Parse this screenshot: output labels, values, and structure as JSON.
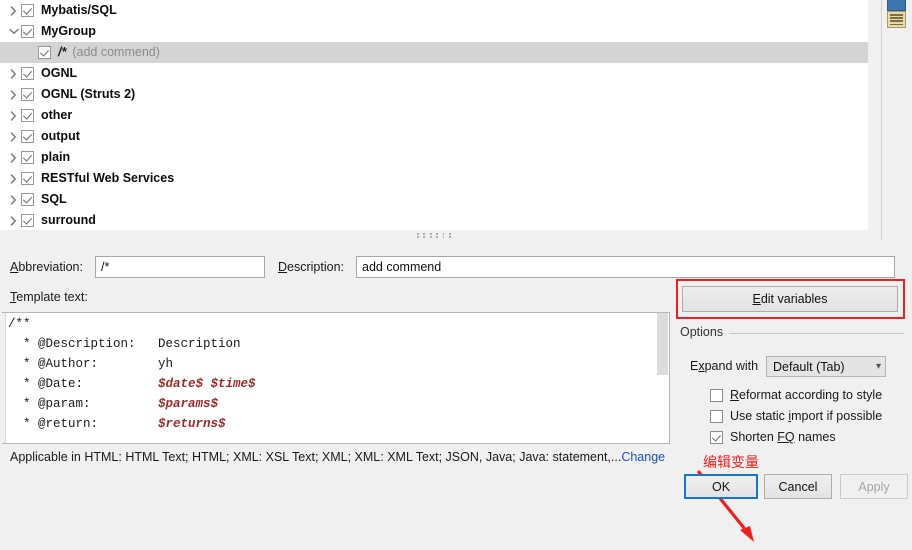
{
  "tree": {
    "items": [
      {
        "label": "Mybatis/SQL",
        "twisty": "chevron-right-icon",
        "checked": true,
        "level": 0,
        "selected": false,
        "desc": ""
      },
      {
        "label": "MyGroup",
        "twisty": "chevron-down-icon",
        "checked": true,
        "level": 0,
        "selected": false,
        "desc": ""
      },
      {
        "label": "/*",
        "twisty": "none",
        "checked": true,
        "level": 1,
        "selected": true,
        "desc": "(add commend)"
      },
      {
        "label": "OGNL",
        "twisty": "chevron-right-icon",
        "checked": true,
        "level": 0,
        "selected": false,
        "desc": ""
      },
      {
        "label": "OGNL (Struts 2)",
        "twisty": "chevron-right-icon",
        "checked": true,
        "level": 0,
        "selected": false,
        "desc": ""
      },
      {
        "label": "other",
        "twisty": "chevron-right-icon",
        "checked": true,
        "level": 0,
        "selected": false,
        "desc": ""
      },
      {
        "label": "output",
        "twisty": "chevron-right-icon",
        "checked": true,
        "level": 0,
        "selected": false,
        "desc": ""
      },
      {
        "label": "plain",
        "twisty": "chevron-right-icon",
        "checked": true,
        "level": 0,
        "selected": false,
        "desc": ""
      },
      {
        "label": "RESTful Web Services",
        "twisty": "chevron-right-icon",
        "checked": true,
        "level": 0,
        "selected": false,
        "desc": ""
      },
      {
        "label": "SQL",
        "twisty": "chevron-right-icon",
        "checked": true,
        "level": 0,
        "selected": false,
        "desc": ""
      },
      {
        "label": "surround",
        "twisty": "chevron-right-icon",
        "checked": true,
        "level": 0,
        "selected": false,
        "desc": ""
      }
    ]
  },
  "form": {
    "abbreviation_label_mnemonic": "A",
    "abbreviation_label_rest": "bbreviation:",
    "abbreviation_value": "/*",
    "description_label_mnemonic": "D",
    "description_label_rest": "escription:",
    "description_value": "add commend",
    "template_text_label_mnemonic": "T",
    "template_text_label_rest": "emplate text:"
  },
  "template": {
    "lines": [
      [
        {
          "t": "/**",
          "v": false
        }
      ],
      [
        {
          "t": "  * @Description:   Description",
          "v": false
        }
      ],
      [
        {
          "t": "  * @Author:        yh",
          "v": false
        }
      ],
      [
        {
          "t": "  * @Date:          ",
          "v": false
        },
        {
          "t": "$date$ $time$",
          "v": true
        }
      ],
      [
        {
          "t": "  * @param:         ",
          "v": false
        },
        {
          "t": "$params$",
          "v": true
        }
      ],
      [
        {
          "t": "  * @return:        ",
          "v": false
        },
        {
          "t": "$returns$",
          "v": true
        }
      ]
    ]
  },
  "edit_variables": {
    "mnemonic": "E",
    "rest": "dit variables"
  },
  "options": {
    "legend": "Options",
    "expand_with_label_pre": "E",
    "expand_with_label_mnemonic": "x",
    "expand_with_label_post": "pand with",
    "expand_with_value": "Default (Tab)",
    "chevron": "chevron-down-icon",
    "checkboxes": [
      {
        "pre": "",
        "mnemonic": "R",
        "post": "eformat according to style",
        "checked": false
      },
      {
        "pre": "Use static ",
        "mnemonic": "i",
        "post": "mport if possible",
        "checked": false
      },
      {
        "pre": "Shorten ",
        "mnemonic": "FQ",
        "post": " names",
        "checked": true
      }
    ]
  },
  "applicable": {
    "text": "Applicable in HTML: HTML Text; HTML; XML: XSL Text; XML; XML: XML Text; JSON, Java; Java: statement,...",
    "change_link": "Change"
  },
  "annotation": {
    "text": "编辑变量",
    "color": "#f02020"
  },
  "buttons": {
    "ok": "OK",
    "cancel": "Cancel",
    "apply": "Apply"
  },
  "colors": {
    "selection": "#d4d4d4",
    "variable_red": "#9b2a28",
    "annotation_red": "#f02020",
    "link_blue": "#1a4fc4",
    "focus_blue": "#1775d1"
  }
}
